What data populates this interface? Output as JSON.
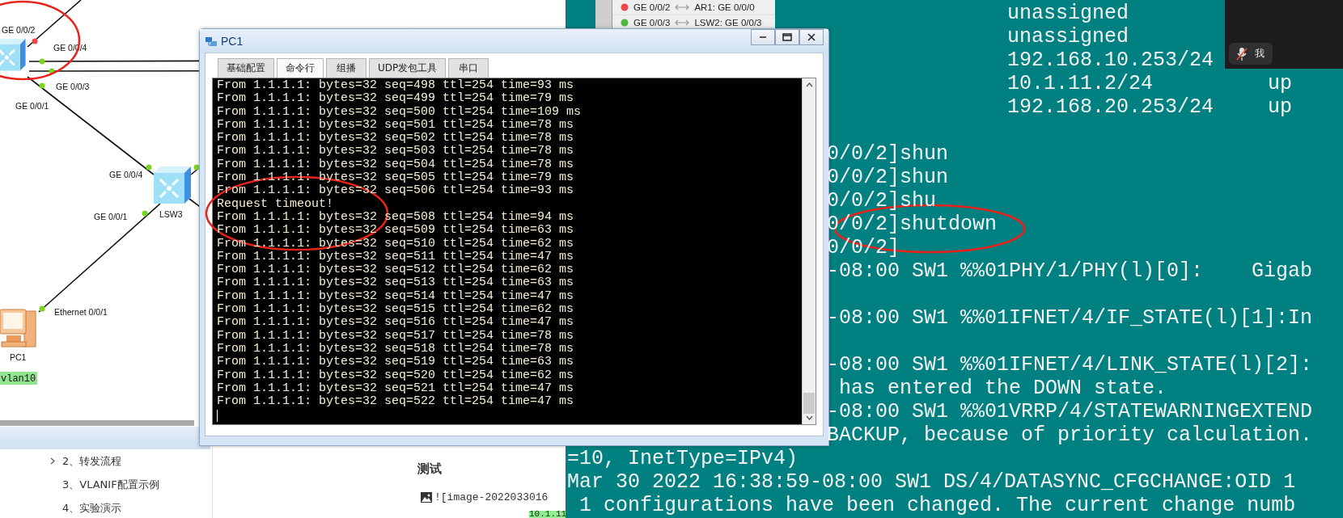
{
  "topology": {
    "nodes": [
      {
        "kind": "switch"
      },
      {
        "kind": "switch",
        "label": "LSW3"
      },
      {
        "kind": "pc",
        "label": "PC1",
        "tag": "vlan10"
      }
    ],
    "ports": [
      {
        "text": "GE 0/0/2",
        "color": "#f04848"
      },
      {
        "text": "GE 0/0/4",
        "color": "#7ed321"
      },
      {
        "text": "GE 0/0/3",
        "color": "#7ed321"
      },
      {
        "text": "GE 0/0/1",
        "color": "#7ed321"
      },
      {
        "text": "GE 0/0/4",
        "color": "#7ed321"
      },
      {
        "text": "GE 0/0/1",
        "color": "#7ed321"
      },
      {
        "text": "Ethernet 0/0/1",
        "color": "#7ed321"
      },
      {
        "color": "#7ed321"
      }
    ]
  },
  "port_list": {
    "rows": [
      {
        "port": "GE 0/0/2",
        "peer": "AR1: GE 0/0/0",
        "color": "#f04848"
      },
      {
        "port": "GE 0/0/3",
        "peer": "LSW2: GE 0/0/3",
        "color": "#4cbb3c"
      }
    ]
  },
  "outline": {
    "items": [
      {
        "text": "2、转发流程",
        "kind": "branch"
      },
      {
        "text": "3、VLANIF配置示例",
        "kind": "leaf"
      },
      {
        "text": "4、实验演示",
        "kind": "leaf"
      }
    ]
  },
  "document": {
    "heading": "测试",
    "image_link": "![image-2022033016",
    "highlight": "10.1.11"
  },
  "terminal": {
    "lines": [
      {
        "kind": "column",
        "text": "unassigned"
      },
      {
        "kind": "column",
        "text": "unassigned"
      },
      {
        "kind": "column",
        "text": "192.168.10.253/24"
      },
      {
        "kind": "column",
        "text": "10.1.11.2/24",
        "status": "up"
      },
      {
        "kind": "column",
        "text": "192.168.20.253/24",
        "status": "up"
      },
      {
        "kind": "blank"
      },
      {
        "kind": "tail",
        "text": "0/0/2]shun"
      },
      {
        "kind": "tail",
        "text": "0/0/2]shun"
      },
      {
        "kind": "tail",
        "text": "0/0/2]shu"
      },
      {
        "kind": "tail",
        "text": "0/0/2]shutdown"
      },
      {
        "kind": "tail",
        "text": "0/0/2]"
      },
      {
        "kind": "tail",
        "text": "-08:00 SW1 %%01PHY/1/PHY(l)[0]:    Gigab"
      },
      {
        "kind": "blank"
      },
      {
        "kind": "tail",
        "text": "-08:00 SW1 %%01IFNET/4/IF_STATE(l)[1]:In"
      },
      {
        "kind": "blank"
      },
      {
        "kind": "tail",
        "text": "-08:00 SW1 %%01IFNET/4/LINK_STATE(l)[2]:"
      },
      {
        "kind": "tail",
        "text": " has entered the DOWN state."
      },
      {
        "kind": "tail",
        "text": "-08:00 SW1 %%01VRRP/4/STATEWARNINGEXTEND"
      },
      {
        "kind": "tail",
        "text": "BACKUP, because of priority calculation."
      },
      {
        "kind": "full",
        "text": "=10, InetType=IPv4)"
      },
      {
        "kind": "full",
        "text": "Mar 30 2022 16:38:59-08:00 SW1 DS/4/DATASYNC_CFGCHANGE:OID 1"
      },
      {
        "kind": "full",
        "text": " 1 configurations have been changed. The current change numb"
      }
    ]
  },
  "call": {
    "label": "我",
    "muted": true
  },
  "pc_window": {
    "title": "PC1",
    "tabs": [
      {
        "label": "基础配置",
        "selected": false
      },
      {
        "label": "命令行",
        "selected": true
      },
      {
        "label": "组播",
        "selected": false
      },
      {
        "label": "UDP发包工具",
        "selected": false
      },
      {
        "label": "串口",
        "selected": false
      }
    ],
    "console_lines": [
      "From 1.1.1.1: bytes=32 seq=498 ttl=254 time=93 ms",
      "From 1.1.1.1: bytes=32 seq=499 ttl=254 time=79 ms",
      "From 1.1.1.1: bytes=32 seq=500 ttl=254 time=109 ms",
      "From 1.1.1.1: bytes=32 seq=501 ttl=254 time=78 ms",
      "From 1.1.1.1: bytes=32 seq=502 ttl=254 time=78 ms",
      "From 1.1.1.1: bytes=32 seq=503 ttl=254 time=78 ms",
      "From 1.1.1.1: bytes=32 seq=504 ttl=254 time=78 ms",
      "From 1.1.1.1: bytes=32 seq=505 ttl=254 time=79 ms",
      "From 1.1.1.1: bytes=32 seq=506 ttl=254 time=93 ms",
      "Request timeout!",
      "From 1.1.1.1: bytes=32 seq=508 ttl=254 time=94 ms",
      "From 1.1.1.1: bytes=32 seq=509 ttl=254 time=63 ms",
      "From 1.1.1.1: bytes=32 seq=510 ttl=254 time=62 ms",
      "From 1.1.1.1: bytes=32 seq=511 ttl=254 time=47 ms",
      "From 1.1.1.1: bytes=32 seq=512 ttl=254 time=62 ms",
      "From 1.1.1.1: bytes=32 seq=513 ttl=254 time=63 ms",
      "From 1.1.1.1: bytes=32 seq=514 ttl=254 time=47 ms",
      "From 1.1.1.1: bytes=32 seq=515 ttl=254 time=62 ms",
      "From 1.1.1.1: bytes=32 seq=516 ttl=254 time=47 ms",
      "From 1.1.1.1: bytes=32 seq=517 ttl=254 time=78 ms",
      "From 1.1.1.1: bytes=32 seq=518 ttl=254 time=78 ms",
      "From 1.1.1.1: bytes=32 seq=519 ttl=254 time=63 ms",
      "From 1.1.1.1: bytes=32 seq=520 ttl=254 time=62 ms",
      "From 1.1.1.1: bytes=32 seq=521 ttl=254 time=47 ms",
      "From 1.1.1.1: bytes=32 seq=522 ttl=254 time=47 ms"
    ]
  }
}
